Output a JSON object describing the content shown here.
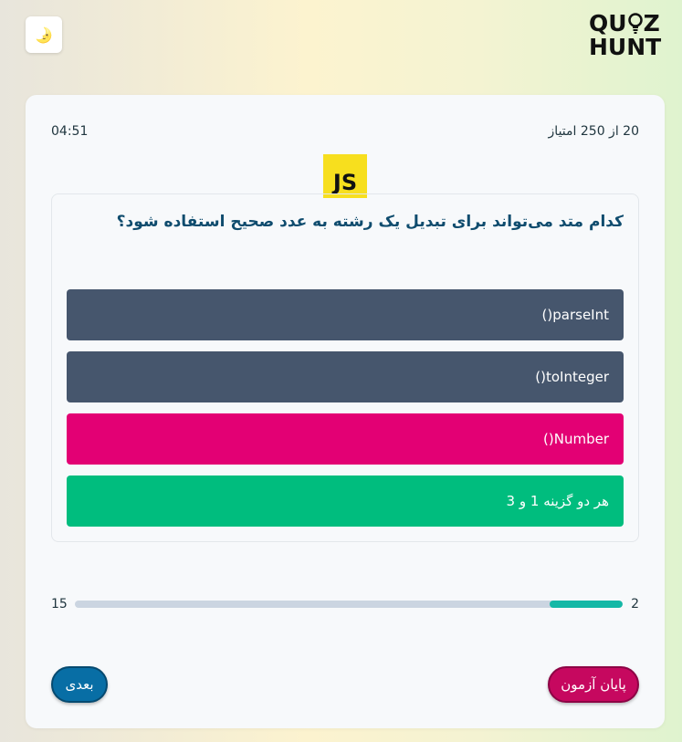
{
  "theme_toggle": {
    "icon": "moon-icon",
    "glyph": "🌛"
  },
  "logo": {
    "line1_a": "QU",
    "line1_b": "Z",
    "line2": "HUNT"
  },
  "quiz": {
    "score_text": "20 از 250 امتیاز",
    "timer": "04:51",
    "topic_logo": "JS",
    "question": "کدام متد می‌تواند برای تبدیل یک رشته به عدد صحیح استفاده شود؟",
    "options": [
      {
        "label": "parseInt()",
        "color": "#46566d"
      },
      {
        "label": "toInteger()",
        "color": "#46566d"
      },
      {
        "label": "Number()",
        "color": "#e30074"
      },
      {
        "label": "هر دو گزینه 1 و 3",
        "color": "#00bd7e"
      }
    ]
  },
  "progress": {
    "current": "2",
    "total": "15",
    "fraction": 0.133,
    "fill_color": "#14b8a6",
    "track_color": "#cbd5e1"
  },
  "buttons": {
    "next_label": "بعدی",
    "end_label": "پایان آزمون"
  }
}
